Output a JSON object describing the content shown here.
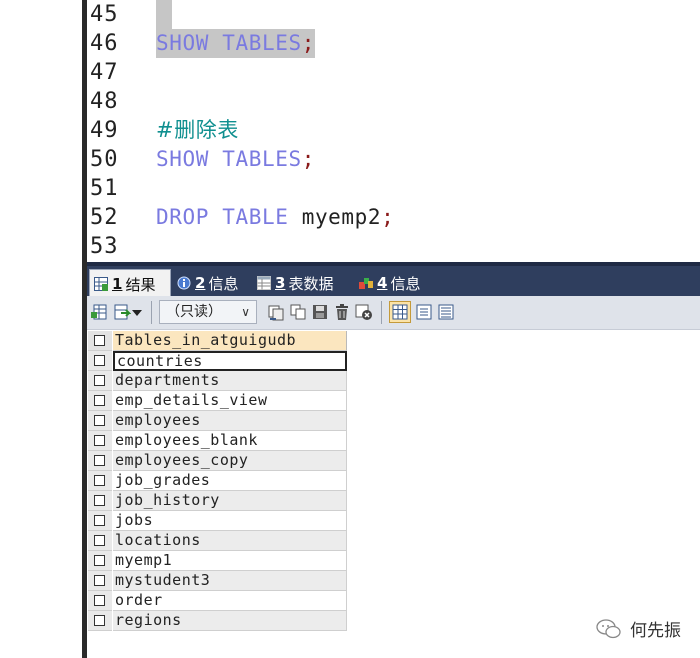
{
  "editor": {
    "lines": [
      {
        "n": "45"
      },
      {
        "n": "46",
        "code": [
          {
            "t": "SHOW",
            "c": "kw"
          },
          {
            "t": " ",
            "c": "ident"
          },
          {
            "t": "TABLES",
            "c": "kw"
          },
          {
            "t": ";",
            "c": "semi"
          }
        ],
        "selected": true
      },
      {
        "n": "47"
      },
      {
        "n": "48"
      },
      {
        "n": "49",
        "code": [
          {
            "t": "#删除表",
            "c": "comment"
          }
        ]
      },
      {
        "n": "50",
        "code": [
          {
            "t": "SHOW",
            "c": "kw"
          },
          {
            "t": " ",
            "c": "ident"
          },
          {
            "t": "TABLES",
            "c": "kw"
          },
          {
            "t": ";",
            "c": "semi"
          }
        ]
      },
      {
        "n": "51"
      },
      {
        "n": "52",
        "code": [
          {
            "t": "DROP",
            "c": "kw"
          },
          {
            "t": " ",
            "c": "ident"
          },
          {
            "t": "TABLE",
            "c": "kw"
          },
          {
            "t": " myemp2",
            "c": "ident"
          },
          {
            "t": ";",
            "c": "semi"
          }
        ]
      },
      {
        "n": "53"
      }
    ]
  },
  "tabs": [
    {
      "num": "1",
      "label": "结果",
      "icon": "grid-result-icon",
      "active": true
    },
    {
      "num": "2",
      "label": "信息",
      "icon": "info-icon",
      "active": false
    },
    {
      "num": "3",
      "label": "表数据",
      "icon": "table-data-icon",
      "active": false
    },
    {
      "num": "4",
      "label": "信息",
      "icon": "info-colored-icon",
      "active": false
    }
  ],
  "toolbar": {
    "mode_value": "（只读）"
  },
  "grid": {
    "header": "Tables_in_atguigudb",
    "rows": [
      "countries",
      "departments",
      "emp_details_view",
      "employees",
      "employees_blank",
      "employees_copy",
      "job_grades",
      "job_history",
      "jobs",
      "locations",
      "myemp1",
      "mystudent3",
      "order",
      "regions"
    ]
  },
  "watermark": {
    "text": "何先振"
  }
}
